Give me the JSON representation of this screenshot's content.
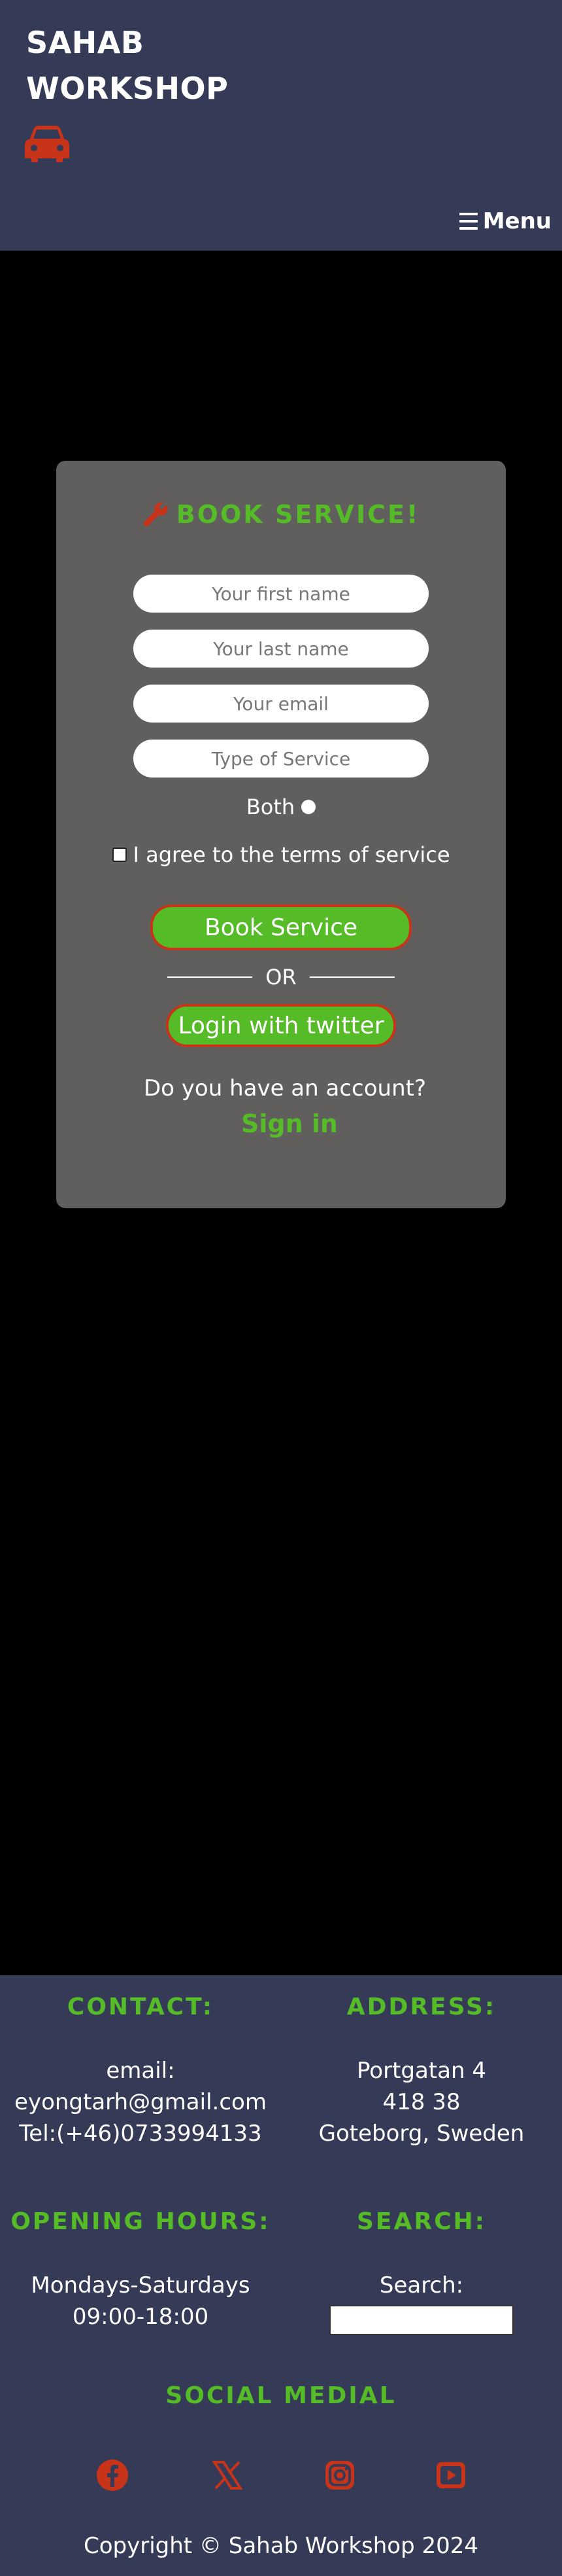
{
  "header": {
    "brand_line1": "SAHAB",
    "brand_line2": "WORKSHOP",
    "menu_label": "Menu",
    "icons": {
      "logo": "car-icon",
      "menu": "hamburger-icon"
    }
  },
  "booking": {
    "title": "BOOK SERVICE!",
    "title_icon": "wrench-icon",
    "fields": {
      "first_name_placeholder": "Your first name",
      "last_name_placeholder": "Your last name",
      "email_placeholder": "Your email",
      "service_placeholder": "Type of Service"
    },
    "radio_label": "Both",
    "terms_label": "I agree to the terms of service",
    "submit_label": "Book Service",
    "or_label": "OR",
    "twitter_label": "Login with twitter",
    "account_question": "Do you have an account?",
    "signin_label": "Sign in"
  },
  "footer": {
    "contact": {
      "heading": "CONTACT:",
      "email_label": "email:",
      "email": "eyongtarh@gmail.com",
      "phone": "Tel:(+46)0733994133"
    },
    "address": {
      "heading": "ADDRESS:",
      "street": "Portgatan 4",
      "postal": "418 38",
      "city": "Goteborg, Sweden"
    },
    "hours": {
      "heading": "OPENING HOURS:",
      "days": "Mondays-Saturdays",
      "time": "09:00-18:00"
    },
    "search": {
      "heading": "SEARCH:",
      "label": "Search:",
      "value": ""
    },
    "social": {
      "heading": "SOCIAL MEDIAL",
      "icons": [
        "facebook-icon",
        "x-twitter-icon",
        "instagram-icon",
        "youtube-icon"
      ]
    },
    "copyright": "Copyright © Sahab Workshop 2024"
  },
  "colors": {
    "header_bg": "#353b56",
    "accent_green": "#55bb26",
    "icon_red": "#c8341a",
    "card_bg": "#605f5e",
    "page_bg": "#000000"
  }
}
